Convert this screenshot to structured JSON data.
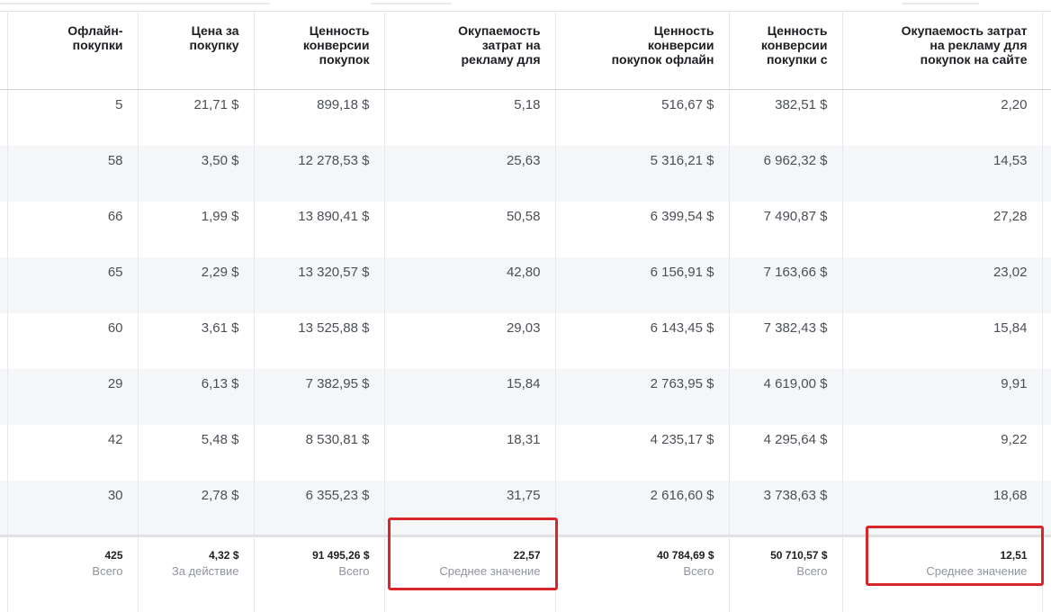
{
  "columns": [
    "",
    "Офлайн-\nпокупки",
    "Цена за\nпокупку",
    "Ценность\nконверсии\nпокупок",
    "Окупаемость\nзатрат на\nрекламу для",
    "Ценность\nконверсии\nпокупок офлайн",
    "Ценность\nконверсии\nпокупки с",
    "Окупаемость затрат\nна рекламу для\nпокупок на сайте"
  ],
  "rows": [
    [
      "5",
      "21,71 $",
      "899,18 $",
      "5,18",
      "516,67 $",
      "382,51 $",
      "2,20"
    ],
    [
      "58",
      "3,50 $",
      "12 278,53 $",
      "25,63",
      "5 316,21 $",
      "6 962,32 $",
      "14,53"
    ],
    [
      "66",
      "1,99 $",
      "13 890,41 $",
      "50,58",
      "6 399,54 $",
      "7 490,87 $",
      "27,28"
    ],
    [
      "65",
      "2,29 $",
      "13 320,57 $",
      "42,80",
      "6 156,91 $",
      "7 163,66 $",
      "23,02"
    ],
    [
      "60",
      "3,61 $",
      "13 525,88 $",
      "29,03",
      "6 143,45 $",
      "7 382,43 $",
      "15,84"
    ],
    [
      "29",
      "6,13 $",
      "7 382,95 $",
      "15,84",
      "2 763,95 $",
      "4 619,00 $",
      "9,91"
    ],
    [
      "42",
      "5,48 $",
      "8 530,81 $",
      "18,31",
      "4 235,17 $",
      "4 295,64 $",
      "9,22"
    ],
    [
      "30",
      "2,78 $",
      "6 355,23 $",
      "31,75",
      "2 616,60 $",
      "3 738,63 $",
      "18,68"
    ]
  ],
  "totals": [
    {
      "value": "425",
      "label": "Всего"
    },
    {
      "value": "4,32 $",
      "label": "За действие"
    },
    {
      "value": "91 495,26 $",
      "label": "Всего"
    },
    {
      "value": "22,57",
      "label": "Среднее значение"
    },
    {
      "value": "40 784,69 $",
      "label": "Всего"
    },
    {
      "value": "50 710,57 $",
      "label": "Всего"
    },
    {
      "value": "12,51",
      "label": "Среднее значение"
    }
  ],
  "highlight_color": "#d9262b"
}
